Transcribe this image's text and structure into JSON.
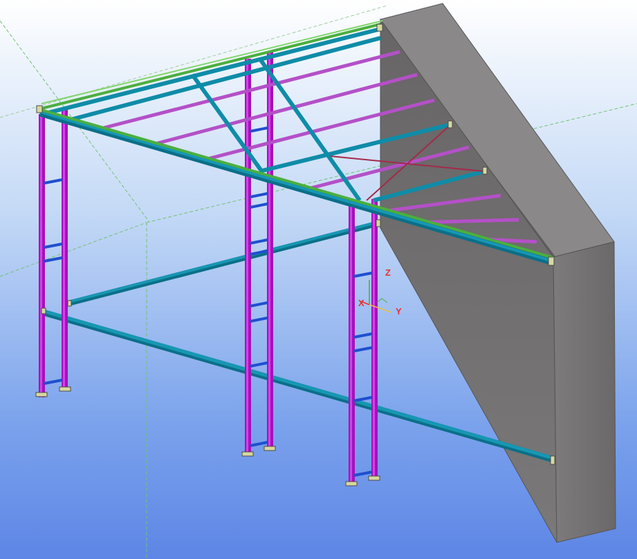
{
  "viewport": {
    "axis_labels": {
      "z": "Z",
      "x": "X",
      "y": "Y"
    }
  },
  "colors": {
    "column": "#b012c8",
    "girder": "#0f8ca8",
    "purlin": "#b450c8",
    "ridge": "#4caf3e",
    "brace": "#a32a4a",
    "rung": "#1f4fcf",
    "wall": "#6d6b6b",
    "axis_label": "#e53131"
  }
}
